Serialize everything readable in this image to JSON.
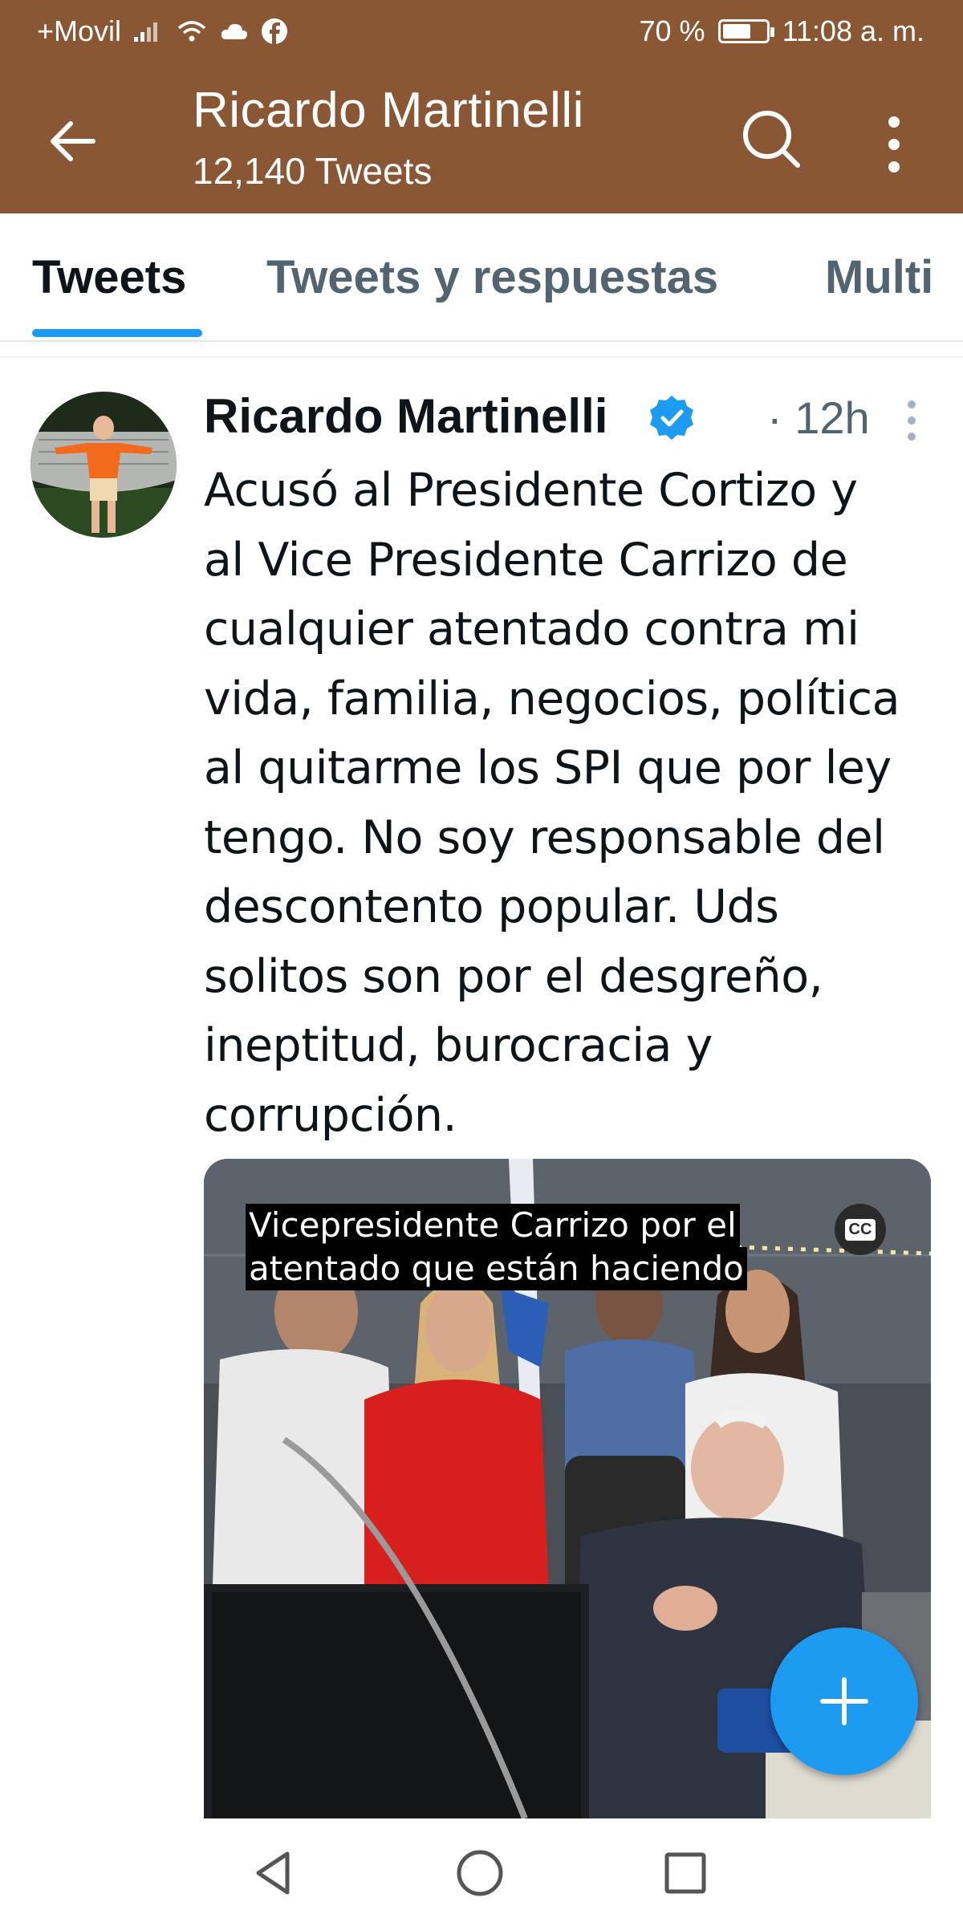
{
  "status_bar": {
    "carrier": "+Movil",
    "battery_text": "70 %",
    "battery_level": 0.7,
    "time": "11:08 a. m.",
    "icons": [
      "signal-icon",
      "wifi-icon",
      "cloud-icon",
      "facebook-icon",
      "battery-icon"
    ]
  },
  "app_bar": {
    "title": "Ricardo Martinelli",
    "subtitle": "12,140 Tweets",
    "icons": [
      "back-arrow-icon",
      "search-icon",
      "more-vertical-icon"
    ]
  },
  "tabs": [
    {
      "label": "Tweets",
      "active": true
    },
    {
      "label": "Tweets y respuestas",
      "active": false
    },
    {
      "label": "Multi",
      "active": false
    }
  ],
  "tweet": {
    "author": "Ricardo Martinelli",
    "time": "· 12h",
    "text_lines": [
      "Acusó al Presidente Cortizo y",
      "al Vice Presidente Carrizo de",
      "cualquier atentado contra mi",
      "vida, familia, negocios, política",
      "al quitarme los SPI que por ley",
      "tengo. No soy responsable del",
      "descontento popular. Uds",
      "solitos son por el desgreño,",
      "ineptitud, burocracia y",
      "corrupción."
    ],
    "media": {
      "caption_lines": [
        "Vicepresidente Carrizo por el",
        "atentado que están haciendo"
      ],
      "cc_label": "CC"
    }
  },
  "colors": {
    "header_bg": "#8a5734",
    "accent": "#1d9bf0",
    "text_primary": "#0f1419",
    "text_secondary": "#536471"
  }
}
